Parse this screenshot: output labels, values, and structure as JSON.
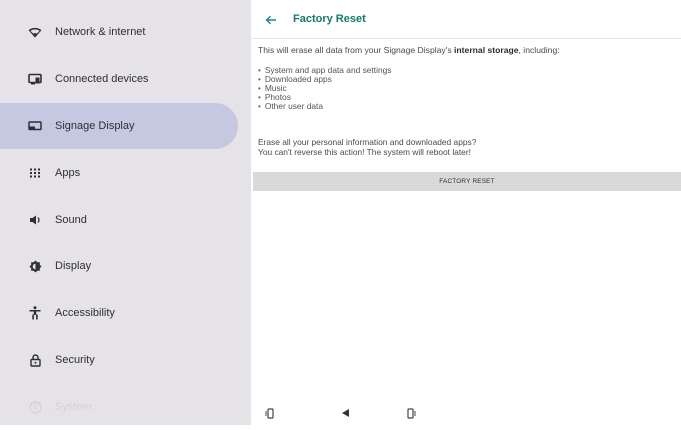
{
  "sidebar": {
    "items": [
      {
        "label": "Network & internet",
        "icon": "wifi-icon"
      },
      {
        "label": "Connected devices",
        "icon": "connected-devices-icon"
      },
      {
        "label": "Signage Display",
        "icon": "signage-display-icon",
        "selected": true
      },
      {
        "label": "Apps",
        "icon": "apps-grid-icon"
      },
      {
        "label": "Sound",
        "icon": "volume-icon"
      },
      {
        "label": "Display",
        "icon": "brightness-icon"
      },
      {
        "label": "Accessibility",
        "icon": "accessibility-icon"
      },
      {
        "label": "Security",
        "icon": "lock-icon"
      },
      {
        "label": "System",
        "icon": "info-icon"
      }
    ]
  },
  "header": {
    "title": "Factory Reset",
    "back_icon": "arrow-back-icon"
  },
  "content": {
    "intro_prefix": "This will erase all data from your Signage Display's ",
    "intro_bold": "internal storage",
    "intro_suffix": ", including:",
    "bullets": [
      "System and app data and settings",
      "Downloaded apps",
      "Music",
      "Photos",
      "Other user data"
    ],
    "warning_line1": "Erase all your personal information and downloaded apps?",
    "warning_line2": "You can't reverse this action! The system will reboot later!",
    "button_label": "FACTORY RESET"
  },
  "navbar": {
    "items": [
      "rotate-left-icon",
      "back-triangle-icon",
      "rotate-right-icon"
    ]
  },
  "colors": {
    "accent": "#0d7d73",
    "sidebar_bg": "#e5e3e8",
    "selected_bg": "#c5c8e0",
    "button_bg": "#d9d9d9"
  }
}
